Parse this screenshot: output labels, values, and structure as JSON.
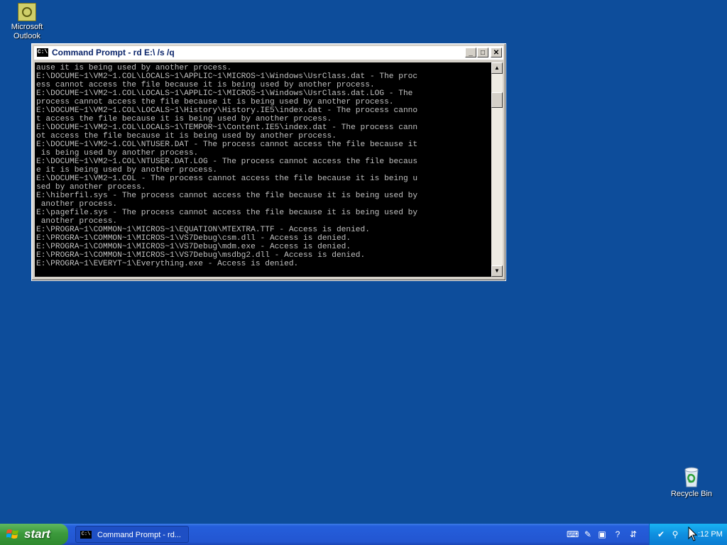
{
  "desktop": {
    "icons": [
      {
        "label": "Microsoft\nOutlook"
      },
      {
        "label": "Recycle Bin"
      }
    ],
    "background_color": "#0d4d9b"
  },
  "window": {
    "title": "Command Prompt - rd E:\\ /s /q",
    "icon_text": "C:\\",
    "buttons": {
      "minimize": "_",
      "maximize": "□",
      "close": "✕"
    },
    "console_lines": [
      "ause it is being used by another process.",
      "E:\\DOCUME~1\\VM2~1.COL\\LOCALS~1\\APPLIC~1\\MICROS~1\\Windows\\UsrClass.dat - The proc",
      "ess cannot access the file because it is being used by another process.",
      "E:\\DOCUME~1\\VM2~1.COL\\LOCALS~1\\APPLIC~1\\MICROS~1\\Windows\\UsrClass.dat.LOG - The",
      "process cannot access the file because it is being used by another process.",
      "E:\\DOCUME~1\\VM2~1.COL\\LOCALS~1\\History\\History.IE5\\index.dat - The process canno",
      "t access the file because it is being used by another process.",
      "E:\\DOCUME~1\\VM2~1.COL\\LOCALS~1\\TEMPOR~1\\Content.IE5\\index.dat - The process cann",
      "ot access the file because it is being used by another process.",
      "E:\\DOCUME~1\\VM2~1.COL\\NTUSER.DAT - The process cannot access the file because it",
      " is being used by another process.",
      "E:\\DOCUME~1\\VM2~1.COL\\NTUSER.DAT.LOG - The process cannot access the file becaus",
      "e it is being used by another process.",
      "E:\\DOCUME~1\\VM2~1.COL - The process cannot access the file because it is being u",
      "sed by another process.",
      "E:\\hiberfil.sys - The process cannot access the file because it is being used by",
      " another process.",
      "E:\\pagefile.sys - The process cannot access the file because it is being used by",
      " another process.",
      "E:\\PROGRA~1\\COMMON~1\\MICROS~1\\EQUATION\\MTEXTRA.TTF - Access is denied.",
      "E:\\PROGRA~1\\COMMON~1\\MICROS~1\\VS7Debug\\csm.dll - Access is denied.",
      "E:\\PROGRA~1\\COMMON~1\\MICROS~1\\VS7Debug\\mdm.exe - Access is denied.",
      "E:\\PROGRA~1\\COMMON~1\\MICROS~1\\VS7Debug\\msdbg2.dll - Access is denied.",
      "E:\\PROGRA~1\\EVERYT~1\\Everything.exe - Access is denied."
    ]
  },
  "taskbar": {
    "start_label": "start",
    "tasks": [
      {
        "label": "Command Prompt - rd...",
        "icon_text": "C:\\"
      }
    ],
    "clock": ":12 PM",
    "tray_icons": [
      "keyboard-icon",
      "pen-icon",
      "network-icon",
      "help-icon",
      "language-icon",
      "shield-icon",
      "search-icon"
    ]
  }
}
